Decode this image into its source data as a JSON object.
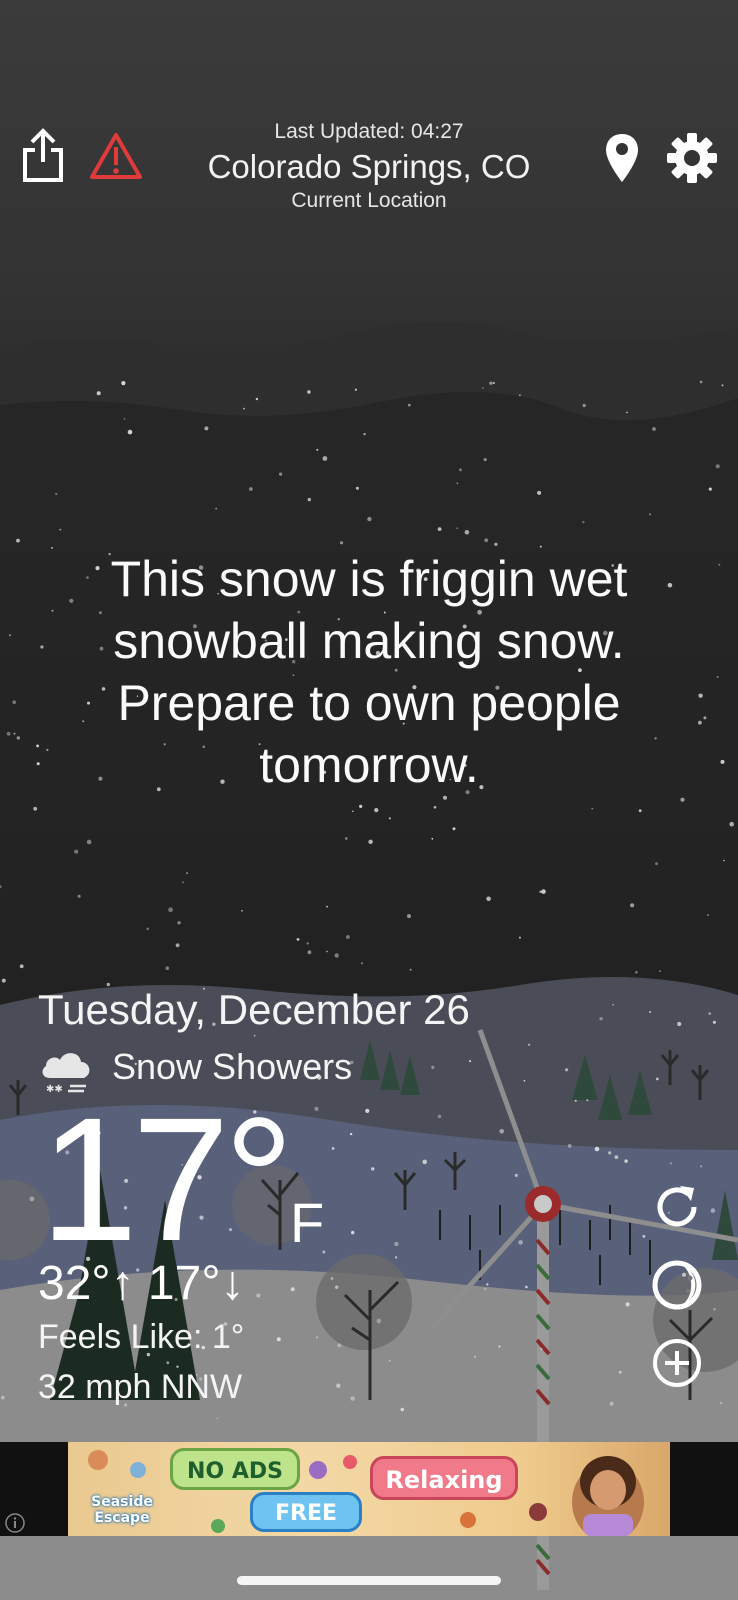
{
  "header": {
    "last_updated": "Last Updated: 04:27",
    "city": "Colorado Springs, CO",
    "location_label": "Current Location"
  },
  "message": "This snow is friggin wet snowball making snow. Prepare to own people tomorrow.",
  "weather": {
    "date": "Tuesday, December 26",
    "condition": "Snow Showers",
    "condition_icon": "snow-cloud-icon",
    "temperature": "17°",
    "unit": "F",
    "high_low": "32°↑  17°↓",
    "feels_like": "Feels Like: 1°",
    "wind": "32 mph NNW"
  },
  "actions": {
    "share_icon": "share-icon",
    "alert_icon": "warning-triangle-icon",
    "location_icon": "location-pin-icon",
    "settings_icon": "gear-icon",
    "refresh_icon": "refresh-icon",
    "moon_icon": "moon-phase-icon",
    "add_icon": "plus-circle-icon"
  },
  "ad": {
    "no_ads": "NO ADS",
    "free": "FREE",
    "relaxing": "Relaxing",
    "logo": "Seaside Escape"
  },
  "colors": {
    "alert_red": "#e03a3a",
    "sky_top": "#3a3a3a",
    "sky_night": "#1f1f1f",
    "snow_ground": "#8a8a8a"
  }
}
